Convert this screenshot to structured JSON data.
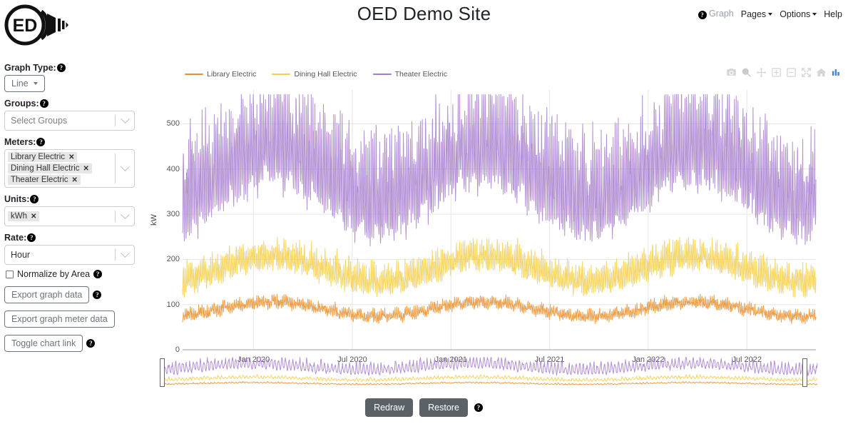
{
  "header": {
    "title": "OED Demo Site",
    "logo_text": "ED",
    "logo_name": "oed-logo",
    "nav": [
      {
        "label": "Graph",
        "icon": "help-circle-icon",
        "state": "active-disabled",
        "caret": false
      },
      {
        "label": "Pages",
        "icon": "",
        "state": "normal",
        "caret": true
      },
      {
        "label": "Options",
        "icon": "",
        "state": "normal",
        "caret": true
      },
      {
        "label": "Help",
        "icon": "",
        "state": "normal",
        "caret": false
      }
    ]
  },
  "sidebar": {
    "graph_type": {
      "label": "Graph Type:",
      "value": "Line"
    },
    "groups": {
      "label": "Groups:",
      "placeholder": "Select Groups",
      "selected": []
    },
    "meters": {
      "label": "Meters:",
      "selected": [
        "Library Electric",
        "Dining Hall Electric",
        "Theater Electric"
      ],
      "remove_glyph": "✕"
    },
    "units": {
      "label": "Units:",
      "selected": [
        "kWh"
      ],
      "remove_glyph": "✕"
    },
    "rate": {
      "label": "Rate:",
      "value": "Hour"
    },
    "normalize": {
      "label": "Normalize by Area",
      "checked": false
    },
    "buttons": [
      {
        "label": "Export graph data",
        "help": true
      },
      {
        "label": "Export graph meter data",
        "help": false
      },
      {
        "label": "Toggle chart link",
        "help": true
      }
    ]
  },
  "chart_data": {
    "type": "line",
    "title": "",
    "xlabel": "",
    "ylabel": "kW",
    "yticks": [
      0,
      100,
      200,
      300,
      400,
      500
    ],
    "ylim": [
      0,
      575
    ],
    "xticks": [
      "Jan 2020",
      "Jul 2020",
      "Jan 2021",
      "Jul 2021",
      "Jan 2022",
      "Jul 2022"
    ],
    "xlim": [
      "Oct 2019",
      "Oct 2022"
    ],
    "grid": true,
    "legend_position": "top-left",
    "series": [
      {
        "name": "Library Electric",
        "color": "#E8912E",
        "baseline": 78,
        "amplitude": 32,
        "spike": 16,
        "seed": 11,
        "approx_range": [
          40,
          130
        ]
      },
      {
        "name": "Dining Hall Electric",
        "color": "#F2CE4A",
        "baseline": 150,
        "amplitude": 55,
        "spike": 48,
        "seed": 29,
        "approx_range": [
          85,
          250
        ]
      },
      {
        "name": "Theater Electric",
        "color": "#A47BCB",
        "baseline": 300,
        "amplitude": 120,
        "spike": 180,
        "seed": 47,
        "approx_range": [
          150,
          565
        ]
      }
    ],
    "rangeslider": {
      "visible": true,
      "handle_left_pct": 0.6,
      "handle_right_pct": 98.4
    }
  },
  "modebar": {
    "items": [
      "camera-icon",
      "zoom-magnifier-icon",
      "pan-arrows-icon",
      "zoom-in-icon",
      "zoom-out-icon",
      "autoscale-icon",
      "home-reset-icon",
      "plotly-logo-icon"
    ]
  },
  "footer": {
    "redraw_label": "Redraw",
    "restore_label": "Restore",
    "help": true
  }
}
